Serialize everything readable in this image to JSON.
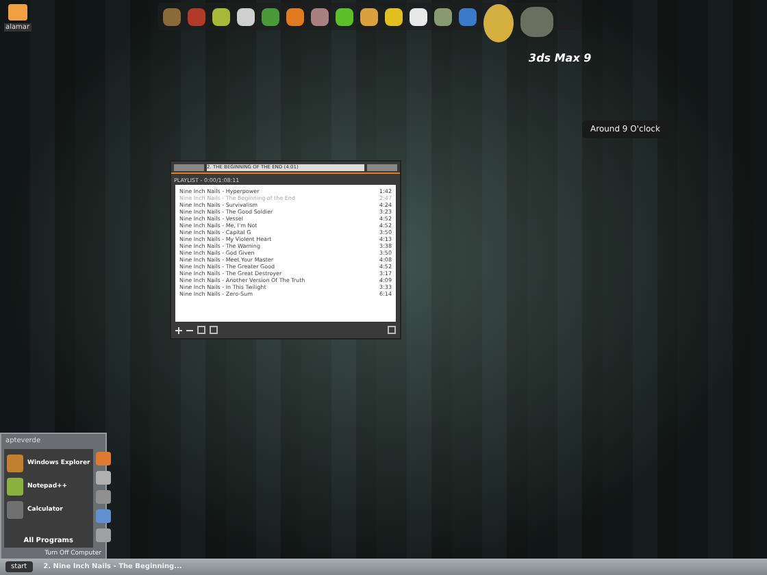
{
  "desktop_icon": {
    "label": "alamar"
  },
  "dock": {
    "caption": "3ds Max 9"
  },
  "tooltip": "Around 9 O'clock",
  "player": {
    "ticker": "2. THE BEGINNING OF THE END (4:01)",
    "playlist_title": "PLAYLIST - 0:00/1:08:11",
    "tracks": [
      {
        "title": "Nine Inch Nails - Hyperpower",
        "time": "1:42",
        "selected": false
      },
      {
        "title": "Nine Inch Nails - The Beginning of the End",
        "time": "2:47",
        "selected": true
      },
      {
        "title": "Nine Inch Nails - Survivalism",
        "time": "4:24",
        "selected": false
      },
      {
        "title": "Nine Inch Nails - The Good Soldier",
        "time": "3:23",
        "selected": false
      },
      {
        "title": "Nine Inch Nails - Vessel",
        "time": "4:52",
        "selected": false
      },
      {
        "title": "Nine Inch Nails - Me, I'm Not",
        "time": "4:52",
        "selected": false
      },
      {
        "title": "Nine Inch Nails - Capital G",
        "time": "3:50",
        "selected": false
      },
      {
        "title": "Nine Inch Nails - My Violent Heart",
        "time": "4:13",
        "selected": false
      },
      {
        "title": "Nine Inch Nails - The Warning",
        "time": "3:38",
        "selected": false
      },
      {
        "title": "Nine Inch Nails - God Given",
        "time": "3:50",
        "selected": false
      },
      {
        "title": "Nine Inch Nails - Meet Your Master",
        "time": "4:08",
        "selected": false
      },
      {
        "title": "Nine Inch Nails - The Greater Good",
        "time": "4:52",
        "selected": false
      },
      {
        "title": "Nine Inch Nails - The Great Destroyer",
        "time": "3:17",
        "selected": false
      },
      {
        "title": "Nine Inch Nails - Another Version Of The Truth",
        "time": "4:09",
        "selected": false
      },
      {
        "title": "Nine Inch Nails - In This Twilight",
        "time": "3:33",
        "selected": false
      },
      {
        "title": "Nine Inch Nails - Zero-Sum",
        "time": "6:14",
        "selected": false
      }
    ]
  },
  "start_menu": {
    "user": "apteverde",
    "programs": [
      {
        "label": "Windows Explorer"
      },
      {
        "label": "Notepad++"
      },
      {
        "label": "Calculator"
      }
    ],
    "all_programs": "All Programs",
    "turn_off": "Turn Off Computer"
  },
  "taskbar": {
    "start": "start",
    "tasks": [
      {
        "label": "2. Nine Inch Nails - The Beginning...",
        "selected": true
      }
    ]
  }
}
